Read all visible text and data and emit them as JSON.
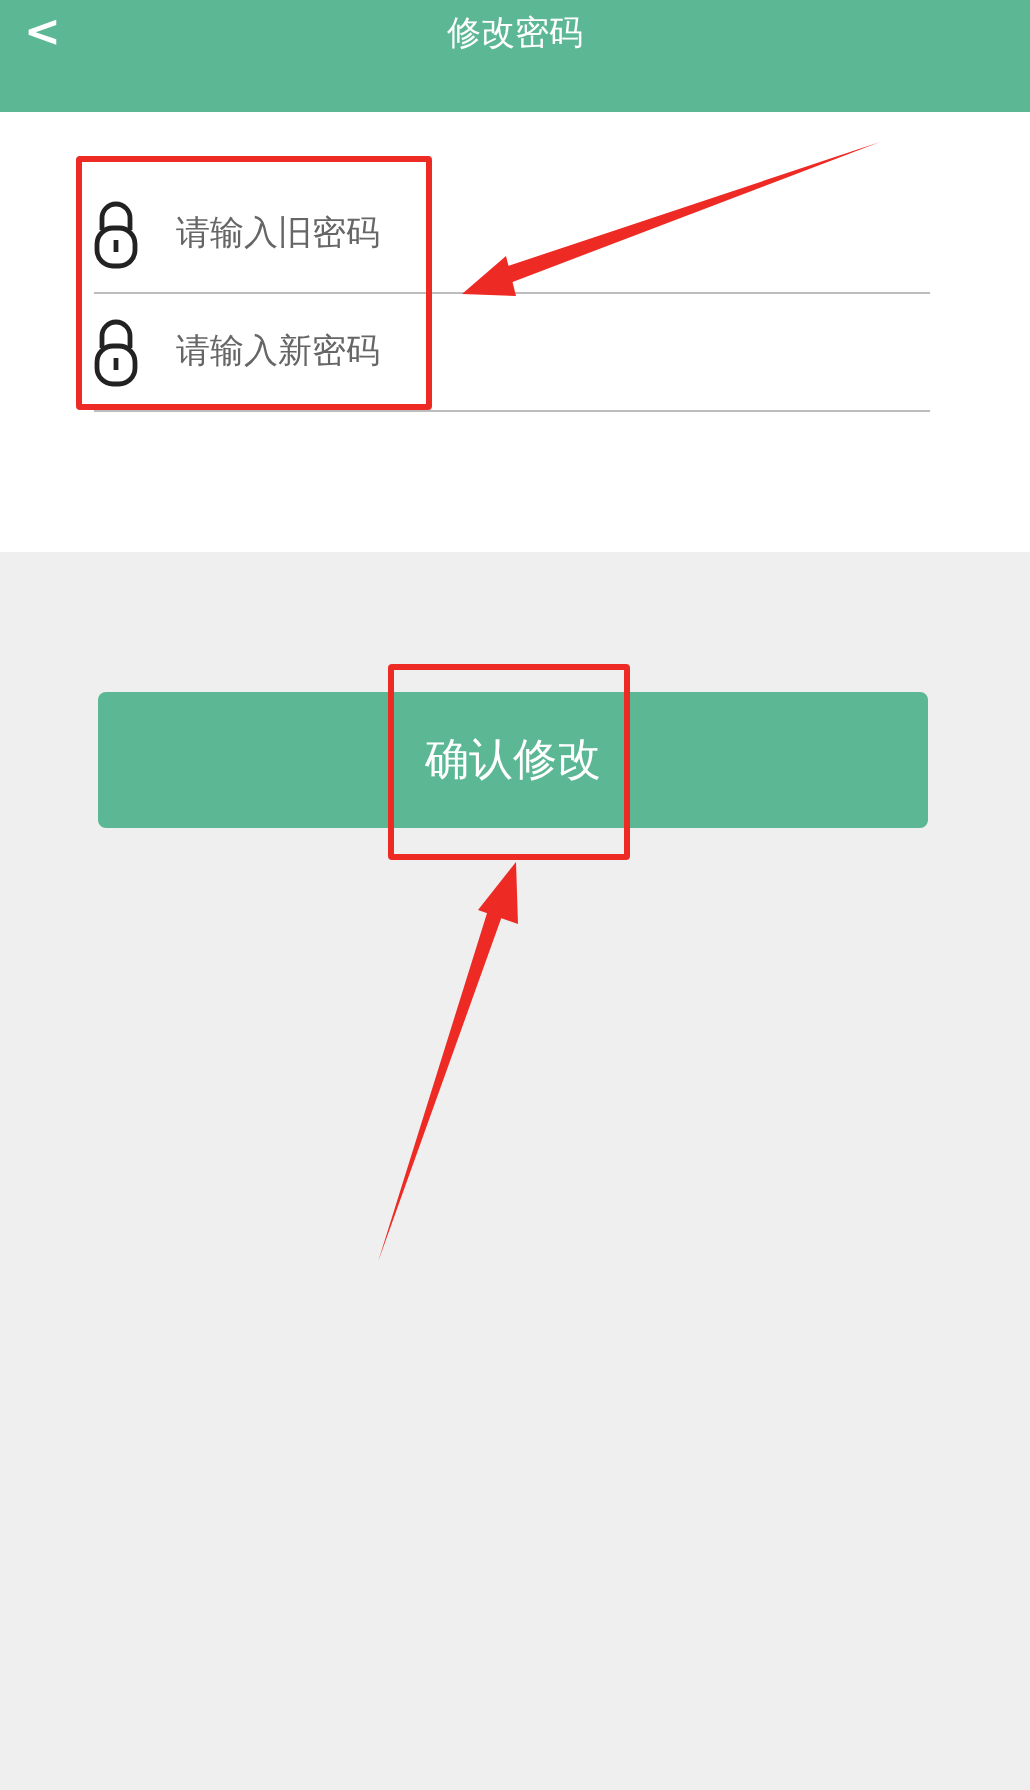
{
  "header": {
    "back": "<",
    "title": "修改密码"
  },
  "fields": [
    {
      "placeholder": "请输入旧密码"
    },
    {
      "placeholder": "请输入新密码"
    }
  ],
  "button": {
    "label": "确认修改"
  }
}
